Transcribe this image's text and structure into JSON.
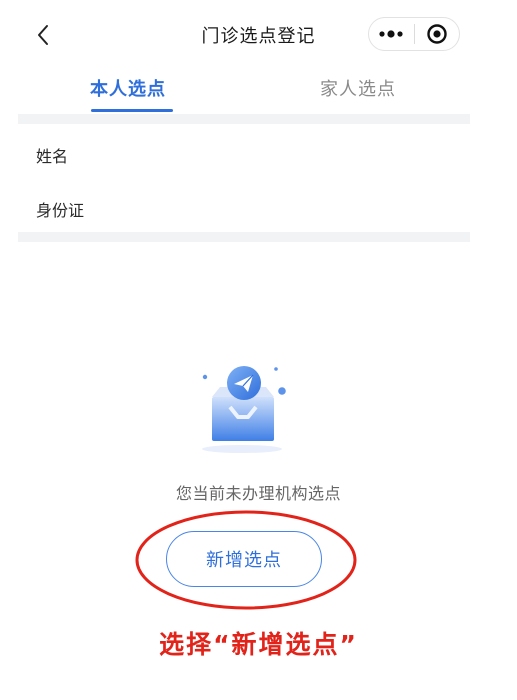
{
  "header": {
    "title": "门诊选点登记"
  },
  "tabs": [
    {
      "label": "本人选点",
      "active": true
    },
    {
      "label": "家人选点",
      "active": false
    }
  ],
  "form": {
    "name_label": "姓名",
    "id_label": "身份证"
  },
  "empty_state": {
    "message": "您当前未办理机构选点",
    "button_label": "新增选点"
  },
  "annotation": {
    "text": "选择“新增选点”",
    "color": "#e2231a"
  },
  "colors": {
    "accent": "#2f6fdb",
    "annotation_red": "#e2231a"
  }
}
